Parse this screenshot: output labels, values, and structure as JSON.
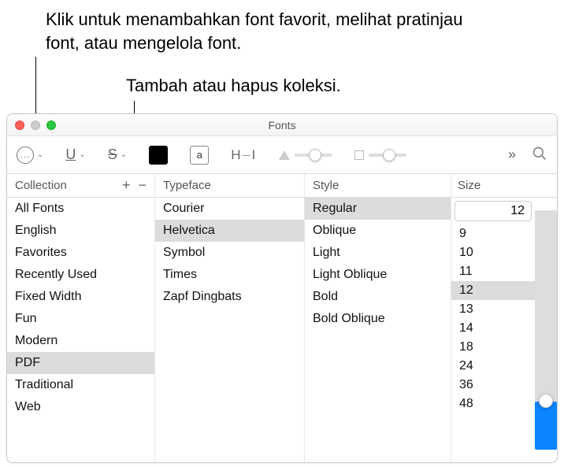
{
  "annotations": {
    "anno1": "Klik untuk menambahkan font favorit, melihat pratinjau font, atau mengelola font.",
    "anno2": "Tambah atau hapus koleksi."
  },
  "window": {
    "title": "Fonts"
  },
  "toolbar": {
    "more_icon": "...",
    "underline": "U",
    "strike": "S",
    "doc_a": "a",
    "spacing": "H‒I"
  },
  "headers": {
    "collection": "Collection",
    "typeface": "Typeface",
    "style": "Style",
    "size": "Size",
    "add": "+",
    "remove": "−"
  },
  "collections": {
    "selected": "PDF",
    "items": [
      "All Fonts",
      "English",
      "Favorites",
      "Recently Used",
      "Fixed Width",
      "Fun",
      "Modern",
      "PDF",
      "Traditional",
      "Web"
    ]
  },
  "typefaces": {
    "selected": "Helvetica",
    "items": [
      "Courier",
      "Helvetica",
      "Symbol",
      "Times",
      "Zapf Dingbats"
    ]
  },
  "styles": {
    "selected": "Regular",
    "items": [
      "Regular",
      "Oblique",
      "Light",
      "Light Oblique",
      "Bold",
      "Bold Oblique"
    ]
  },
  "size": {
    "value": "12",
    "selected": "12",
    "items": [
      "9",
      "10",
      "11",
      "12",
      "13",
      "14",
      "18",
      "24",
      "36",
      "48"
    ]
  }
}
